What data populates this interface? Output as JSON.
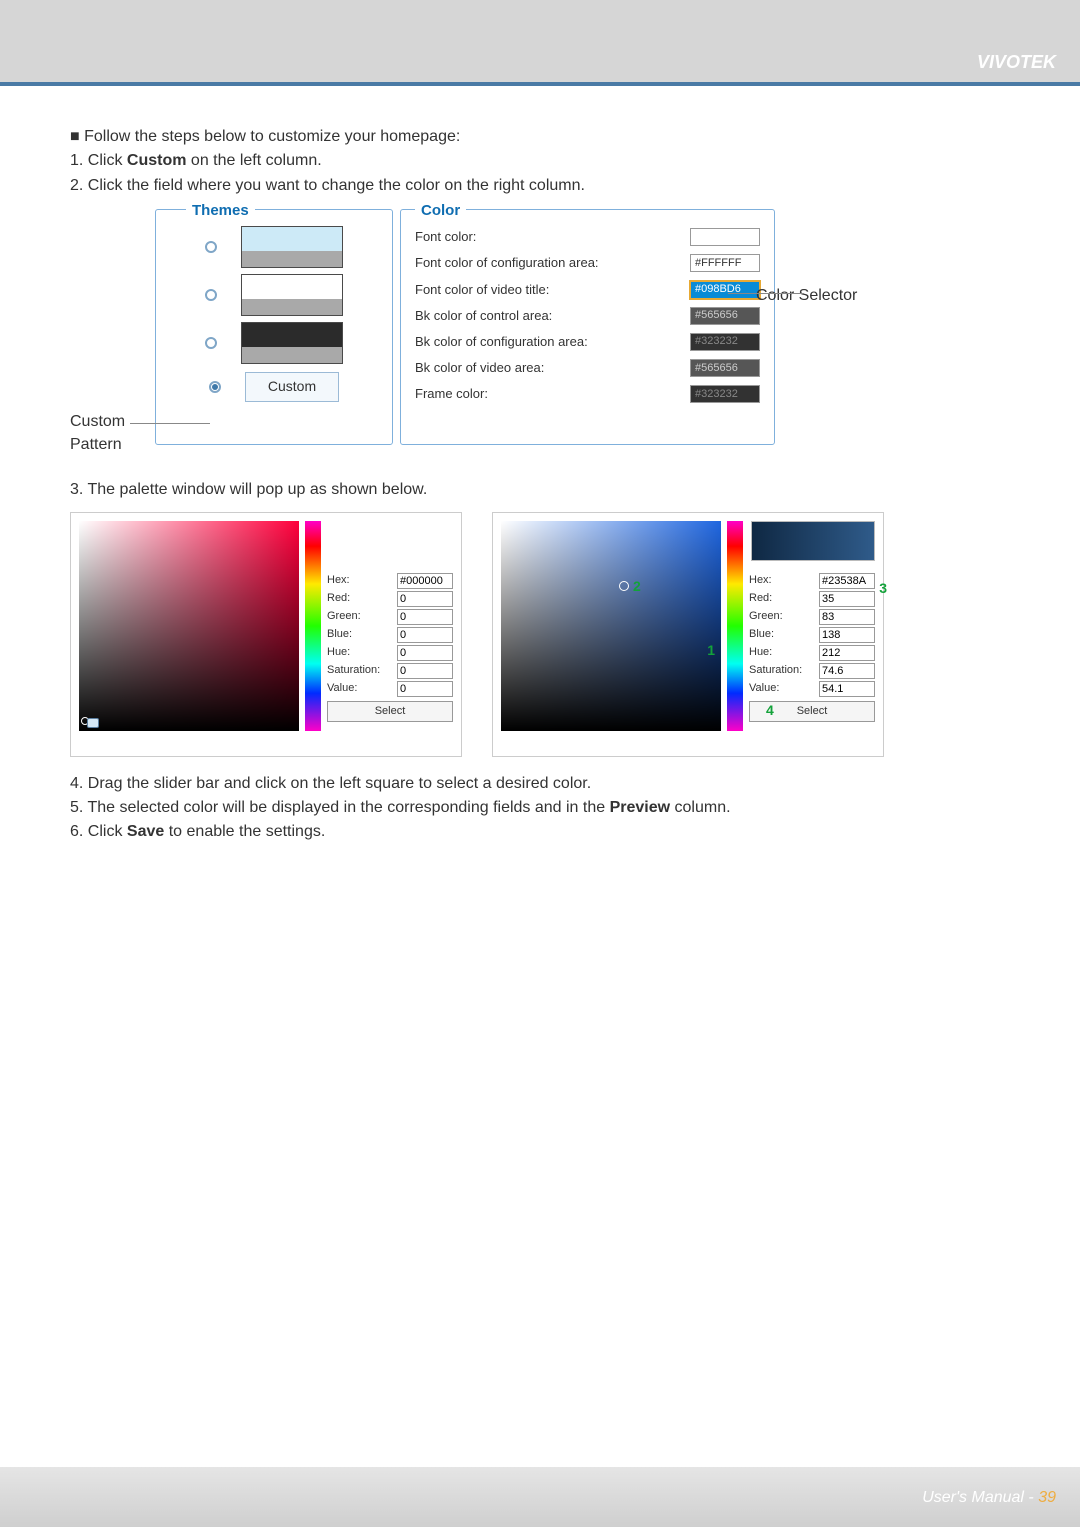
{
  "brand": "VIVOTEK",
  "intro_bullet": "■ Follow the steps below to customize your homepage:",
  "step1_pre": "1. Click ",
  "step1_bold": "Custom",
  "step1_post": " on the left column.",
  "step2": "2. Click the field where you want to change the color on the right column.",
  "themes_legend": "Themes",
  "custom_label": "Custom",
  "color_legend": "Color",
  "color_rows": {
    "r0": {
      "label": "Font color:",
      "value": ""
    },
    "r1": {
      "label": "Font color of configuration area:",
      "value": "#FFFFFF"
    },
    "r2": {
      "label": "Font color of video title:",
      "value": "#098BD6"
    },
    "r3": {
      "label": "Bk color of control area:",
      "value": "#565656"
    },
    "r4": {
      "label": "Bk color of configuration area:",
      "value": "#323232"
    },
    "r5": {
      "label": "Bk color of video area:",
      "value": "#565656"
    },
    "r6": {
      "label": "Frame color:",
      "value": "#323232"
    }
  },
  "anno_custom_l1": "Custom",
  "anno_custom_l2": "Pattern",
  "anno_selector": "Color Selector",
  "step3": "3. The palette window will pop up as shown below.",
  "palette_left": {
    "hex_label": "Hex:",
    "hex": "#000000",
    "red_label": "Red:",
    "red": "0",
    "green_label": "Green:",
    "green": "0",
    "blue_label": "Blue:",
    "blue": "0",
    "hue_label": "Hue:",
    "hue": "0",
    "sat_label": "Saturation:",
    "sat": "0",
    "val_label": "Value:",
    "val": "0",
    "select": "Select"
  },
  "palette_right": {
    "hex_label": "Hex:",
    "hex": "#23538A",
    "red_label": "Red:",
    "red": "35",
    "green_label": "Green:",
    "green": "83",
    "blue_label": "Blue:",
    "blue": "138",
    "hue_label": "Hue:",
    "hue": "212",
    "sat_label": "Saturation:",
    "sat": "74.6",
    "val_label": "Value:",
    "val": "54.1",
    "select": "Select"
  },
  "callouts": {
    "c1": "1",
    "c2": "2",
    "c3": "3",
    "c4": "4"
  },
  "step4": "4. Drag the slider bar and click on the left square to select a desired color.",
  "step5_pre": "5. The selected color will be displayed in the corresponding fields and in the ",
  "step5_bold": "Preview",
  "step5_post": " column.",
  "step6_pre": "6. Click ",
  "step6_bold": "Save",
  "step6_post": " to enable the settings.",
  "footer": "User's Manual - ",
  "page_no": "39"
}
